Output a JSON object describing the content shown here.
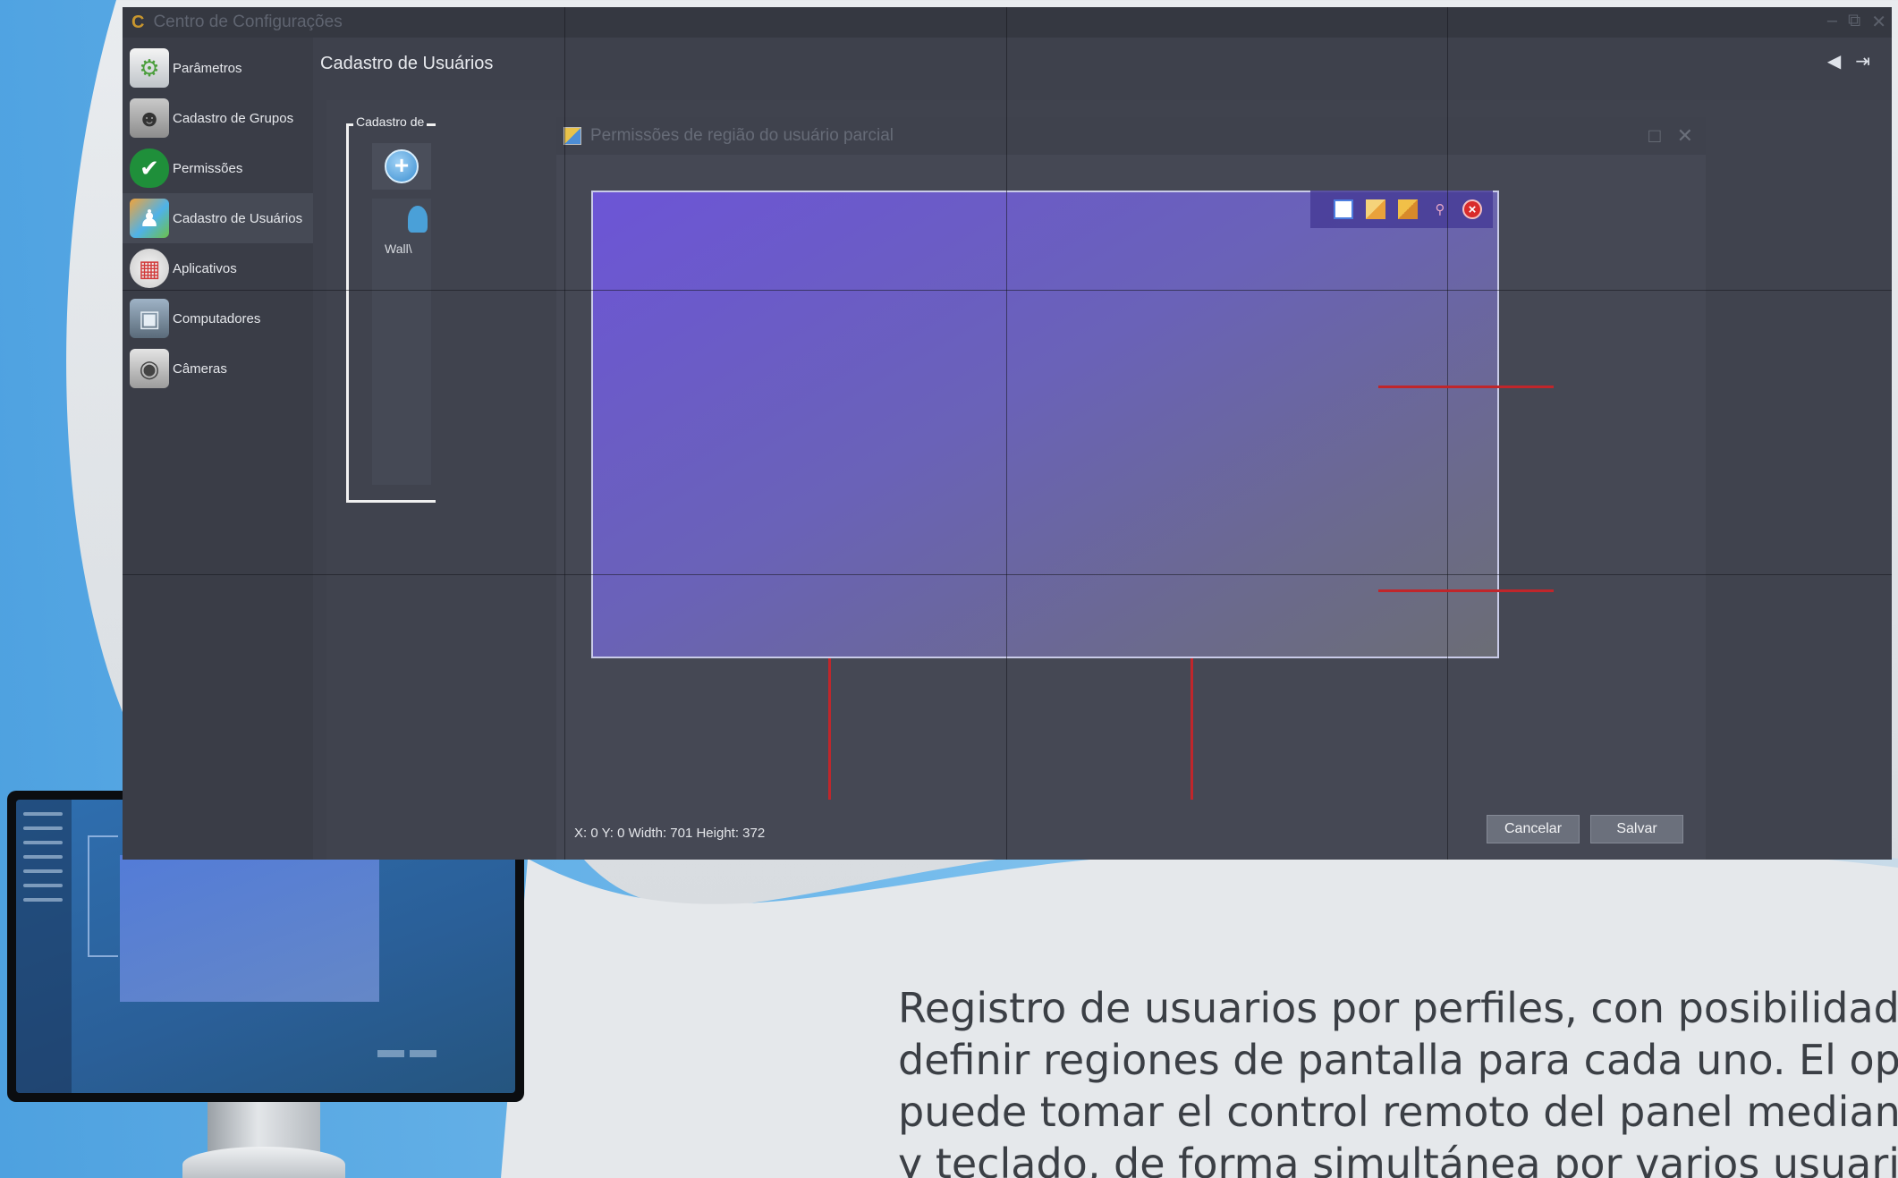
{
  "window": {
    "title": "Centro de Configurações",
    "logo": "C",
    "controls": [
      "minimize-icon",
      "restore-icon",
      "close-icon"
    ]
  },
  "sidebar": {
    "items": [
      {
        "label": "Parâmetros",
        "icon": "settings-icon",
        "active": false
      },
      {
        "label": "Cadastro de Grupos",
        "icon": "group-icon",
        "active": false
      },
      {
        "label": "Permissões",
        "icon": "shield-check-icon",
        "active": false
      },
      {
        "label": "Cadastro de Usuários",
        "icon": "users-icon",
        "active": true
      },
      {
        "label": "Aplicativos",
        "icon": "apps-icon",
        "active": false
      },
      {
        "label": "Computadores",
        "icon": "monitor-icon",
        "active": false
      },
      {
        "label": "Câmeras",
        "icon": "camera-icon",
        "active": false
      }
    ]
  },
  "content": {
    "page_title": "Cadastro de Usuários",
    "group_label": "Cadastro de",
    "user_label": "Wall\\"
  },
  "dialog": {
    "title": "Permissões de região do usuário parcial",
    "coords": "X: 0  Y: 0  Width: 701  Height: 372",
    "cancel_label": "Cancelar",
    "save_label": "Salvar",
    "toolbar": [
      "select-region-icon",
      "copy-region-icon",
      "paste-region-icon",
      "magnify-icon",
      "close-region-icon"
    ]
  },
  "caption": {
    "lines": [
      "Registro de usuarios por perfiles, con posibilidad de",
      "definir regiones de pantalla para cada uno. El operador",
      "puede tomar el control remoto del panel mediante mouse",
      "y teclado, de forma simultánea por varios usuarios."
    ]
  },
  "colors": {
    "app_bg": "#3d404b",
    "region_start": "#6c55d6",
    "region_end": "#6b6d75",
    "guide_red": "#c0262b",
    "wave_blue": "#4aa6e6"
  }
}
